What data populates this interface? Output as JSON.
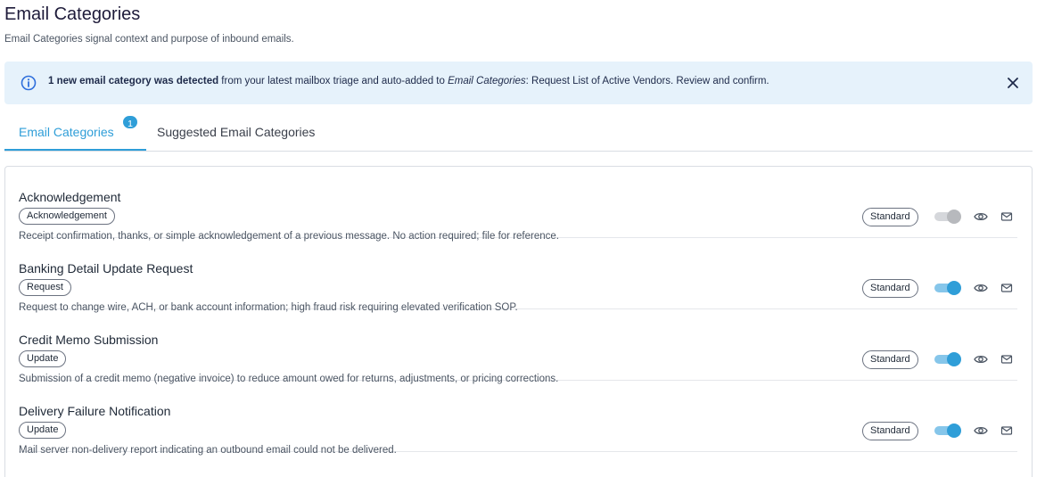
{
  "page": {
    "title": "Email Categories",
    "subtitle": "Email Categories signal context and purpose of inbound emails."
  },
  "banner": {
    "icon": "info-circle-icon",
    "bold_text": "1 new email category was detected",
    "text_1": " from your latest mailbox triage and auto-added to ",
    "italic_text": "Email Categories",
    "text_2": ": Request List of Active Vendors. Review and confirm.",
    "close_icon": "close-icon"
  },
  "tabs": [
    {
      "label": "Email Categories",
      "badge": "1",
      "active": true
    },
    {
      "label": "Suggested Email Categories",
      "active": false
    }
  ],
  "categories": [
    {
      "title": "Acknowledgement",
      "tag": "Acknowledgement",
      "description": "Receipt confirmation, thanks, or simple acknowledgement of a previous message. No action required; file for reference.",
      "badge": "Standard",
      "enabled": false
    },
    {
      "title": "Banking Detail Update Request",
      "tag": "Request",
      "description": "Request to change wire, ACH, or bank account information; high fraud risk requiring elevated verification SOP.",
      "badge": "Standard",
      "enabled": true
    },
    {
      "title": "Credit Memo Submission",
      "tag": "Update",
      "description": "Submission of a credit memo (negative invoice) to reduce amount owed for returns, adjustments, or pricing corrections.",
      "badge": "Standard",
      "enabled": true
    },
    {
      "title": "Delivery Failure Notification",
      "tag": "Update",
      "description": "Mail server non-delivery report indicating an outbound email could not be delivered.",
      "badge": "Standard",
      "enabled": true
    }
  ],
  "colors": {
    "accent": "#2f9ed8",
    "banner_bg": "#e6f2fb"
  }
}
